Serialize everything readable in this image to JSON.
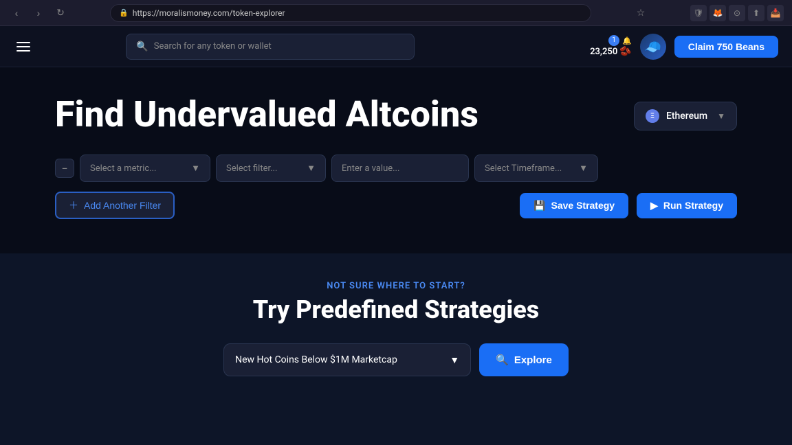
{
  "browser": {
    "url": "https://moralismoney.com/token-explorer",
    "nav_back": "‹",
    "nav_forward": "›",
    "nav_refresh": "↻"
  },
  "navbar": {
    "search_placeholder": "Search for any token or wallet",
    "beans_notification": "1",
    "beans_count": "23,250",
    "bean_icon": "🫘",
    "claim_button": "Claim 750 Beans"
  },
  "hero": {
    "title": "Find Undervalued Altcoins",
    "network": "Ethereum",
    "filter": {
      "metric_placeholder": "Select a metric...",
      "filter_placeholder": "Select filter...",
      "value_placeholder": "Enter a value...",
      "timeframe_placeholder": "Select Timeframe..."
    },
    "add_filter_button": "Add Another Filter",
    "save_strategy_button": "Save Strategy",
    "run_strategy_button": "Run Strategy"
  },
  "lower": {
    "not_sure_label": "NOT SURE WHERE TO START?",
    "predefined_title": "Try Predefined Strategies",
    "strategy_option": "New Hot Coins Below $1M Marketcap",
    "explore_button": "Explore"
  }
}
